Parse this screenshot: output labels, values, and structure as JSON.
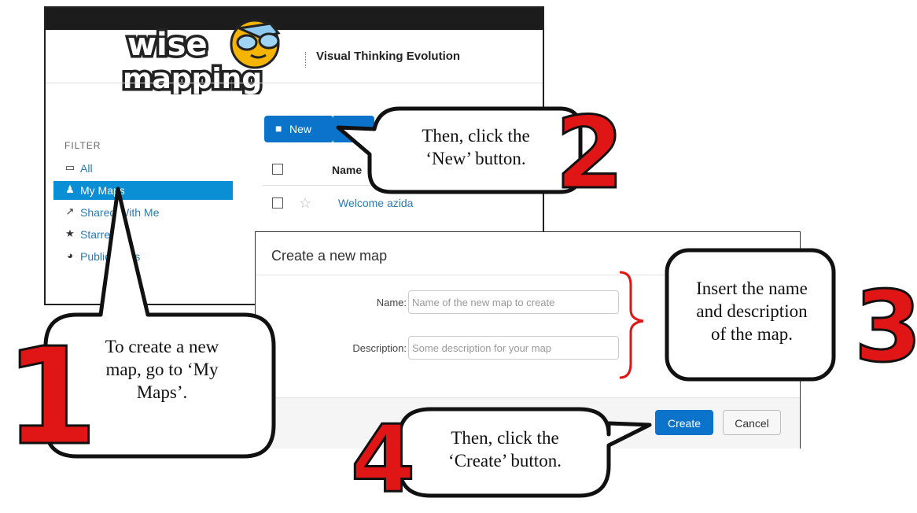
{
  "app": {
    "logo_line1": "wise",
    "logo_line2": "mapping",
    "tagline": "Visual Thinking Evolution",
    "filter_title": "FILTER",
    "filters": [
      {
        "label": "All",
        "icon": "inbox-icon",
        "glyph": "▭",
        "active": false
      },
      {
        "label": "My Maps",
        "icon": "user-icon",
        "glyph": "♟",
        "active": true
      },
      {
        "label": "Shared With Me",
        "icon": "share-icon",
        "glyph": "↗",
        "active": false
      },
      {
        "label": "Starred",
        "icon": "star-icon",
        "glyph": "★",
        "active": false
      },
      {
        "label": "Public Maps",
        "icon": "globe-icon",
        "glyph": "◕",
        "active": false
      }
    ],
    "toolbar": {
      "new_label": "New",
      "new_icon": "document-icon"
    },
    "table": {
      "col_name": "Name",
      "rows": [
        {
          "name": "Welcome azida",
          "starred": false
        }
      ]
    }
  },
  "dialog": {
    "title": "Create a new map",
    "name_label": "Name:",
    "name_placeholder": "Name of the new map to create",
    "desc_label": "Description:",
    "desc_placeholder": "Some description for your map",
    "create_label": "Create",
    "cancel_label": "Cancel"
  },
  "callouts": [
    {
      "number": "1",
      "text": [
        "To create a new",
        "map, go to ‘My",
        "Maps’."
      ]
    },
    {
      "number": "2",
      "text": [
        "Then, click the",
        "‘New’ button."
      ]
    },
    {
      "number": "3",
      "text": [
        "Insert the name",
        "and description",
        "of the map."
      ]
    },
    {
      "number": "4",
      "text": [
        "Then, click the",
        "‘Create’ button."
      ]
    }
  ],
  "colors": {
    "accent": "#0b73c9",
    "active_filter": "#0a8fd4",
    "step_number": "#e01515",
    "bracket": "#e01515"
  }
}
